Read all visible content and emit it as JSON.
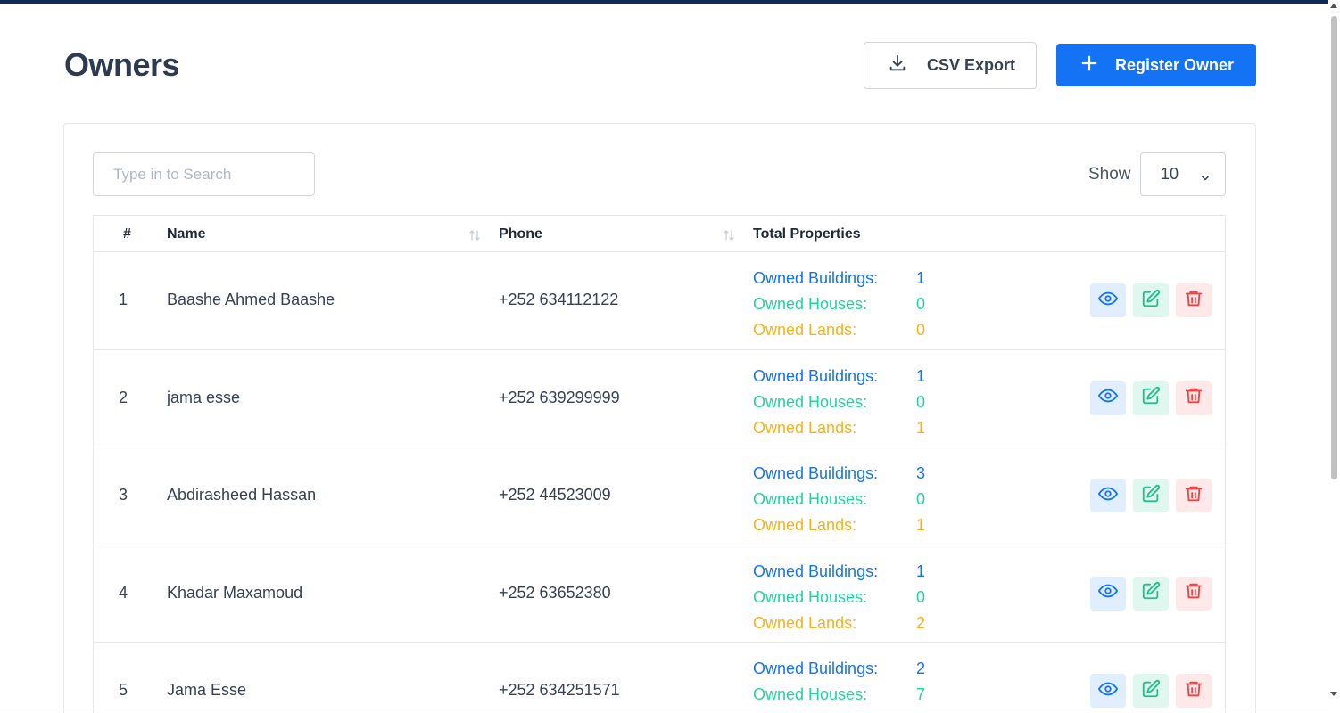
{
  "header": {
    "title": "Owners",
    "csv_label": "CSV Export",
    "register_label": "Register Owner"
  },
  "search": {
    "placeholder": "Type in to Search"
  },
  "pagination": {
    "show_label": "Show",
    "page_size": "10"
  },
  "table": {
    "columns": {
      "num": "#",
      "name": "Name",
      "phone": "Phone",
      "properties": "Total Properties"
    },
    "property_labels": {
      "buildings": "Owned Buildings:",
      "houses": "Owned Houses:",
      "lands": "Owned Lands:"
    },
    "rows": [
      {
        "num": "1",
        "name": "Baashe Ahmed Baashe",
        "phone": "+252 634112122",
        "buildings": "1",
        "houses": "0",
        "lands": "0"
      },
      {
        "num": "2",
        "name": "jama esse",
        "phone": "+252 639299999",
        "buildings": "1",
        "houses": "0",
        "lands": "1"
      },
      {
        "num": "3",
        "name": "Abdirasheed Hassan",
        "phone": "+252 44523009",
        "buildings": "3",
        "houses": "0",
        "lands": "1"
      },
      {
        "num": "4",
        "name": "Khadar Maxamoud",
        "phone": "+252 63652380",
        "buildings": "1",
        "houses": "0",
        "lands": "2"
      },
      {
        "num": "5",
        "name": "Jama Esse",
        "phone": "+252 634251571",
        "buildings": "2",
        "houses": "7",
        "lands": ""
      }
    ]
  },
  "colors": {
    "primary": "#1473f5",
    "houses": "#22d3a0",
    "lands": "#f5b21b",
    "danger": "#ef4444"
  },
  "icons": [
    "download-icon",
    "plus-icon",
    "chevron-down-icon",
    "sort-icon",
    "eye-icon",
    "edit-icon",
    "trash-icon"
  ]
}
